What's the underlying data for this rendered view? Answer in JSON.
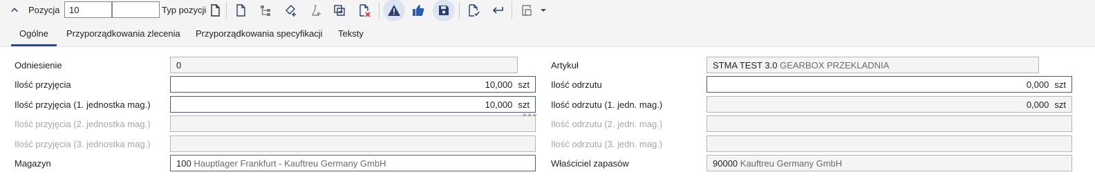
{
  "toolbar": {
    "pos_label": "Pozycja",
    "pos_value": "10",
    "pos_value2": "",
    "typ_label": "Typ pozycji"
  },
  "tabs": [
    {
      "label": "Ogólne"
    },
    {
      "label": "Przyporządkowania zlecenia"
    },
    {
      "label": "Przyporządkowania specyfikacji"
    },
    {
      "label": "Teksty"
    }
  ],
  "form": {
    "odniesienie": {
      "label": "Odniesienie",
      "value": "0"
    },
    "ilosc_przyjecia": {
      "label": "Ilość przyjęcia",
      "value": "10,000",
      "unit": "szt"
    },
    "ilosc_przyjecia_1": {
      "label": "Ilość przyjęcia (1. jednostka mag.)",
      "value": "10,000",
      "unit": "szt"
    },
    "ilosc_przyjecia_2": {
      "label": "Ilość przyjęcia (2. jednostka mag.)",
      "value": ""
    },
    "ilosc_przyjecia_3": {
      "label": "Ilość przyjęcia (3. jednostka mag.)",
      "value": ""
    },
    "magazyn": {
      "label": "Magazyn",
      "code": "100",
      "desc": "Hauptlager Frankfurt -  Kauftreu Germany GmbH"
    },
    "artykul": {
      "label": "Artykuł",
      "code": "STMA TEST 3.0",
      "desc": "GEARBOX PRZEKLADNIA"
    },
    "ilosc_odrzutu": {
      "label": "Ilość odrzutu",
      "value": "0,000",
      "unit": "szt"
    },
    "ilosc_odrzutu_1": {
      "label": "Ilość odrzutu (1. jedn. mag.)",
      "value": "0,000",
      "unit": "szt"
    },
    "ilosc_odrzutu_2": {
      "label": "Ilość odrzutu (2. jedn. mag.)",
      "value": ""
    },
    "ilosc_odrzutu_3": {
      "label": "Ilość odrzutu (3. jedn. mag.)",
      "value": ""
    },
    "wlasciciel": {
      "label": "Właściciel zapasów",
      "code": "90000",
      "desc": "Kauftreu Germany GmbH"
    },
    "more_symbol": "∘∘∘"
  },
  "colors": {
    "accent": "#2c4a8c",
    "icon_blue": "#2a3f6b",
    "warning_red": "#d12f2f",
    "bg": "#f4f4f4"
  }
}
